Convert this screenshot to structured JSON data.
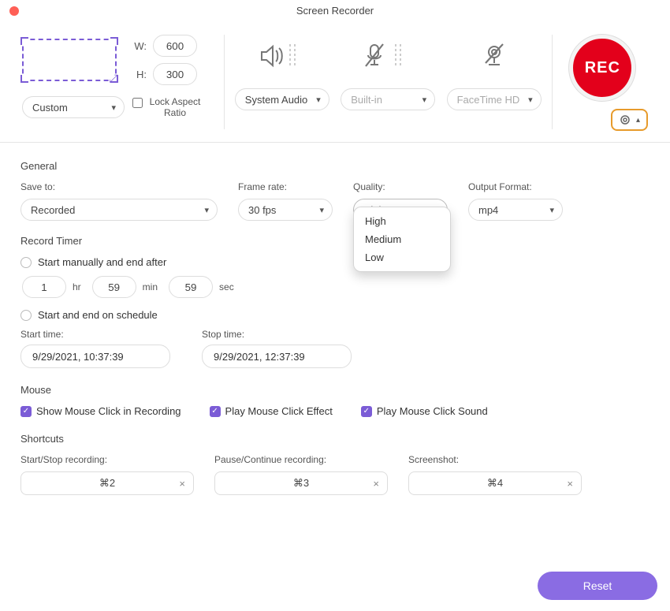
{
  "window": {
    "title": "Screen Recorder"
  },
  "top": {
    "w_label": "W:",
    "h_label": "H:",
    "w_value": "600",
    "h_value": "300",
    "region_mode": "Custom",
    "lock_aspect_label": "Lock Aspect Ratio",
    "audio_select": "System Audio",
    "mic_select": "Built-in",
    "camera_select": "FaceTime HD",
    "rec_label": "REC"
  },
  "general": {
    "title": "General",
    "save_to": {
      "label": "Save to:",
      "value": "Recorded"
    },
    "frame_rate": {
      "label": "Frame rate:",
      "value": "30 fps"
    },
    "quality": {
      "label": "Quality:",
      "value": "High",
      "options": [
        "High",
        "Medium",
        "Low"
      ]
    },
    "output_format": {
      "label": "Output Format:",
      "value": "mp4"
    }
  },
  "timer": {
    "title": "Record Timer",
    "manual_label": "Start manually and end after",
    "hr": "1",
    "min": "59",
    "sec": "59",
    "hr_unit": "hr",
    "min_unit": "min",
    "sec_unit": "sec",
    "schedule_label": "Start and end on schedule",
    "start_label": "Start time:",
    "stop_label": "Stop time:",
    "start_value": "9/29/2021, 10:37:39",
    "stop_value": "9/29/2021, 12:37:39"
  },
  "mouse": {
    "title": "Mouse",
    "show_click": "Show Mouse Click in Recording",
    "play_effect": "Play Mouse Click Effect",
    "play_sound": "Play Mouse Click Sound"
  },
  "shortcuts": {
    "title": "Shortcuts",
    "start_stop": {
      "label": "Start/Stop recording:",
      "value": "⌘2"
    },
    "pause_continue": {
      "label": "Pause/Continue recording:",
      "value": "⌘3"
    },
    "screenshot": {
      "label": "Screenshot:",
      "value": "⌘4"
    }
  },
  "footer": {
    "reset": "Reset"
  }
}
